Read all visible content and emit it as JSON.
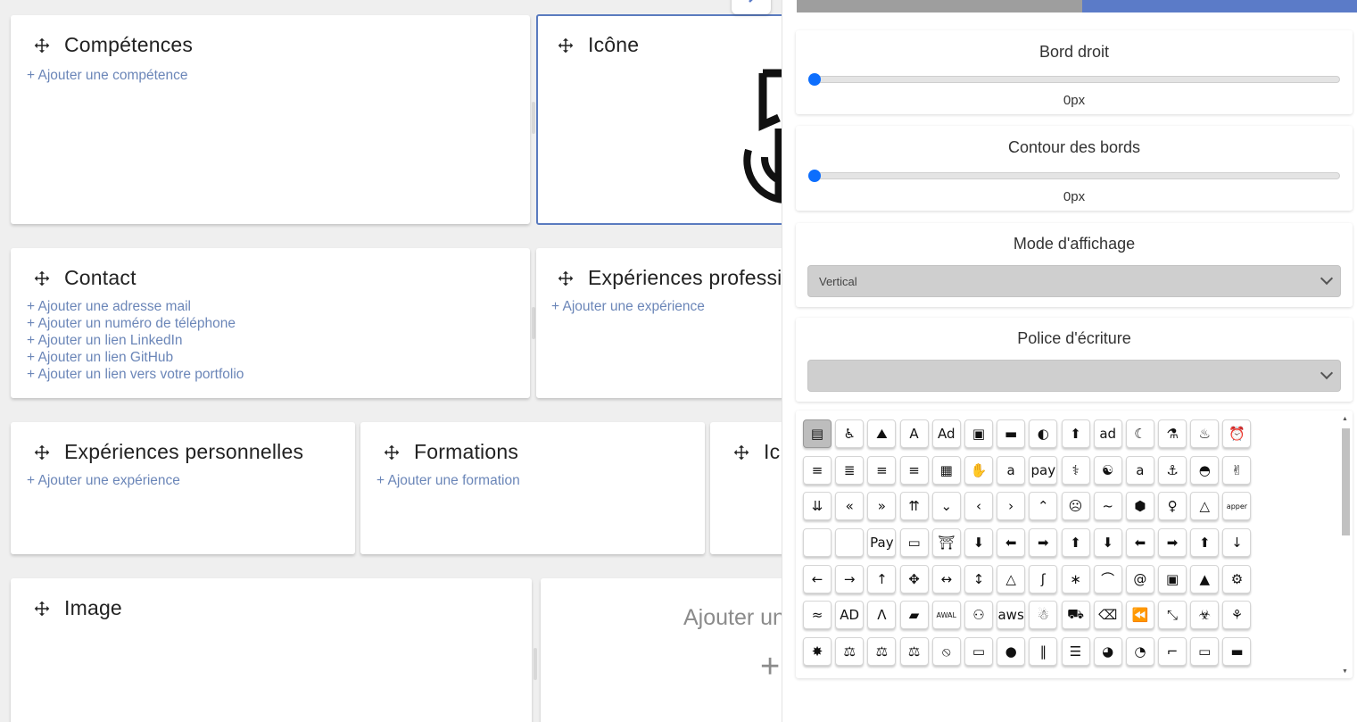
{
  "canvas": {
    "cards": {
      "competences": {
        "title": "Compétences",
        "links": [
          "+ Ajouter une compétence"
        ]
      },
      "icone": {
        "title": "Icône"
      },
      "contact": {
        "title": "Contact",
        "links": [
          "+ Ajouter une adresse mail",
          "+ Ajouter un numéro de téléphone",
          "+ Ajouter un lien LinkedIn",
          "+ Ajouter un lien GitHub",
          "+ Ajouter un lien vers votre portfolio"
        ]
      },
      "exp_pro": {
        "title": "Expériences professi",
        "links": [
          "+ Ajouter une expérience"
        ]
      },
      "exp_perso": {
        "title": "Expériences personnelles",
        "links": [
          "+ Ajouter une expérience"
        ]
      },
      "formations": {
        "title": "Formations",
        "links": [
          "+ Ajouter une formation"
        ]
      },
      "icone2": {
        "title": "Ic"
      },
      "image": {
        "title": "Image"
      },
      "add_card": {
        "label": "Ajouter un",
        "plus": "+"
      }
    }
  },
  "panel": {
    "bord_droit": {
      "title": "Bord droit",
      "value": "0px",
      "level": 0
    },
    "contour": {
      "title": "Contour des bords",
      "value": "0px",
      "level": 0
    },
    "mode": {
      "title": "Mode d'affichage",
      "selected": "Vertical"
    },
    "police": {
      "title": "Police d'écriture",
      "selected": ""
    },
    "icons": [
      [
        "▤",
        "♿",
        "⛰",
        "A",
        "Ad",
        "▣",
        "▬",
        "◐",
        "⬆",
        "ad",
        "☾",
        "⚗",
        "♨",
        "⏰"
      ],
      [
        "≡",
        "≣",
        "≡",
        "≡",
        "▦",
        "✋",
        "a",
        "pay",
        "⚕",
        "☯",
        "a",
        "⚓",
        "◓",
        "✌"
      ],
      [
        "⇊",
        "«",
        "»",
        "⇈",
        "⌄",
        "‹",
        "›",
        "⌃",
        "☹",
        "~",
        "⬢",
        "♀",
        "△",
        "apper"
      ],
      [
        "",
        "",
        "Pay",
        "▭",
        "⛩",
        "⬇",
        "⬅",
        "➡",
        "⬆",
        "⬇",
        "⬅",
        "➡",
        "⬆",
        "↓"
      ],
      [
        "←",
        "→",
        "↑",
        "✥",
        "↔",
        "↕",
        "△",
        "ʃ",
        "∗",
        "⌒",
        "@",
        "▣",
        "▲",
        "⚙"
      ],
      [
        "≈",
        "AD",
        "Ʌ",
        "▰",
        "AWAL",
        "⚇",
        "aws",
        "☃",
        "⛟",
        "⌫",
        "⏪",
        "⤡",
        "☣",
        "⚘"
      ],
      [
        "✸",
        "⚖",
        "⚖",
        "⚖",
        "⦸",
        "▭",
        "●",
        "‖",
        "☰",
        "◕",
        "◔",
        "⌐",
        "▭",
        "▬"
      ]
    ]
  }
}
